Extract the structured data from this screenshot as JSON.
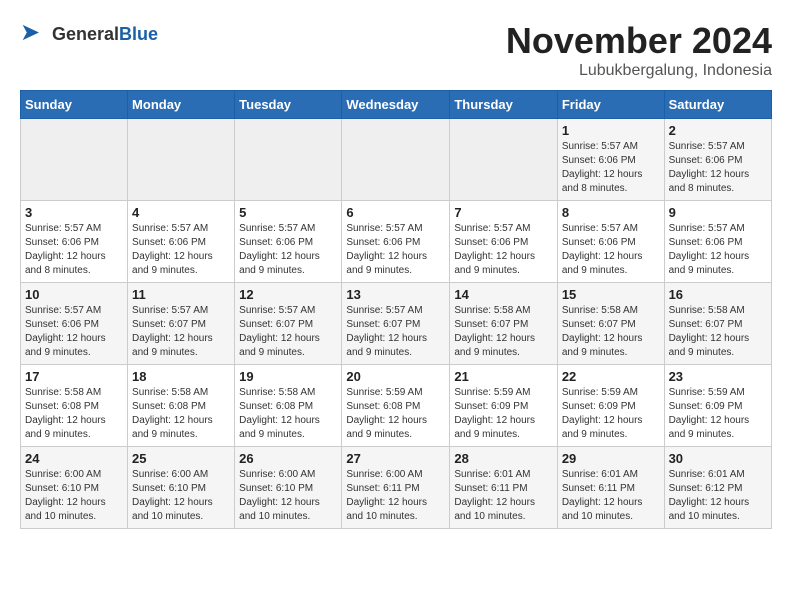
{
  "header": {
    "logo_general": "General",
    "logo_blue": "Blue",
    "month_title": "November 2024",
    "location": "Lubukbergalung, Indonesia"
  },
  "weekdays": [
    "Sunday",
    "Monday",
    "Tuesday",
    "Wednesday",
    "Thursday",
    "Friday",
    "Saturday"
  ],
  "weeks": [
    [
      {
        "day": "",
        "info": ""
      },
      {
        "day": "",
        "info": ""
      },
      {
        "day": "",
        "info": ""
      },
      {
        "day": "",
        "info": ""
      },
      {
        "day": "",
        "info": ""
      },
      {
        "day": "1",
        "info": "Sunrise: 5:57 AM\nSunset: 6:06 PM\nDaylight: 12 hours and 8 minutes."
      },
      {
        "day": "2",
        "info": "Sunrise: 5:57 AM\nSunset: 6:06 PM\nDaylight: 12 hours and 8 minutes."
      }
    ],
    [
      {
        "day": "3",
        "info": "Sunrise: 5:57 AM\nSunset: 6:06 PM\nDaylight: 12 hours and 8 minutes."
      },
      {
        "day": "4",
        "info": "Sunrise: 5:57 AM\nSunset: 6:06 PM\nDaylight: 12 hours and 9 minutes."
      },
      {
        "day": "5",
        "info": "Sunrise: 5:57 AM\nSunset: 6:06 PM\nDaylight: 12 hours and 9 minutes."
      },
      {
        "day": "6",
        "info": "Sunrise: 5:57 AM\nSunset: 6:06 PM\nDaylight: 12 hours and 9 minutes."
      },
      {
        "day": "7",
        "info": "Sunrise: 5:57 AM\nSunset: 6:06 PM\nDaylight: 12 hours and 9 minutes."
      },
      {
        "day": "8",
        "info": "Sunrise: 5:57 AM\nSunset: 6:06 PM\nDaylight: 12 hours and 9 minutes."
      },
      {
        "day": "9",
        "info": "Sunrise: 5:57 AM\nSunset: 6:06 PM\nDaylight: 12 hours and 9 minutes."
      }
    ],
    [
      {
        "day": "10",
        "info": "Sunrise: 5:57 AM\nSunset: 6:06 PM\nDaylight: 12 hours and 9 minutes."
      },
      {
        "day": "11",
        "info": "Sunrise: 5:57 AM\nSunset: 6:07 PM\nDaylight: 12 hours and 9 minutes."
      },
      {
        "day": "12",
        "info": "Sunrise: 5:57 AM\nSunset: 6:07 PM\nDaylight: 12 hours and 9 minutes."
      },
      {
        "day": "13",
        "info": "Sunrise: 5:57 AM\nSunset: 6:07 PM\nDaylight: 12 hours and 9 minutes."
      },
      {
        "day": "14",
        "info": "Sunrise: 5:58 AM\nSunset: 6:07 PM\nDaylight: 12 hours and 9 minutes."
      },
      {
        "day": "15",
        "info": "Sunrise: 5:58 AM\nSunset: 6:07 PM\nDaylight: 12 hours and 9 minutes."
      },
      {
        "day": "16",
        "info": "Sunrise: 5:58 AM\nSunset: 6:07 PM\nDaylight: 12 hours and 9 minutes."
      }
    ],
    [
      {
        "day": "17",
        "info": "Sunrise: 5:58 AM\nSunset: 6:08 PM\nDaylight: 12 hours and 9 minutes."
      },
      {
        "day": "18",
        "info": "Sunrise: 5:58 AM\nSunset: 6:08 PM\nDaylight: 12 hours and 9 minutes."
      },
      {
        "day": "19",
        "info": "Sunrise: 5:58 AM\nSunset: 6:08 PM\nDaylight: 12 hours and 9 minutes."
      },
      {
        "day": "20",
        "info": "Sunrise: 5:59 AM\nSunset: 6:08 PM\nDaylight: 12 hours and 9 minutes."
      },
      {
        "day": "21",
        "info": "Sunrise: 5:59 AM\nSunset: 6:09 PM\nDaylight: 12 hours and 9 minutes."
      },
      {
        "day": "22",
        "info": "Sunrise: 5:59 AM\nSunset: 6:09 PM\nDaylight: 12 hours and 9 minutes."
      },
      {
        "day": "23",
        "info": "Sunrise: 5:59 AM\nSunset: 6:09 PM\nDaylight: 12 hours and 9 minutes."
      }
    ],
    [
      {
        "day": "24",
        "info": "Sunrise: 6:00 AM\nSunset: 6:10 PM\nDaylight: 12 hours and 10 minutes."
      },
      {
        "day": "25",
        "info": "Sunrise: 6:00 AM\nSunset: 6:10 PM\nDaylight: 12 hours and 10 minutes."
      },
      {
        "day": "26",
        "info": "Sunrise: 6:00 AM\nSunset: 6:10 PM\nDaylight: 12 hours and 10 minutes."
      },
      {
        "day": "27",
        "info": "Sunrise: 6:00 AM\nSunset: 6:11 PM\nDaylight: 12 hours and 10 minutes."
      },
      {
        "day": "28",
        "info": "Sunrise: 6:01 AM\nSunset: 6:11 PM\nDaylight: 12 hours and 10 minutes."
      },
      {
        "day": "29",
        "info": "Sunrise: 6:01 AM\nSunset: 6:11 PM\nDaylight: 12 hours and 10 minutes."
      },
      {
        "day": "30",
        "info": "Sunrise: 6:01 AM\nSunset: 6:12 PM\nDaylight: 12 hours and 10 minutes."
      }
    ]
  ]
}
